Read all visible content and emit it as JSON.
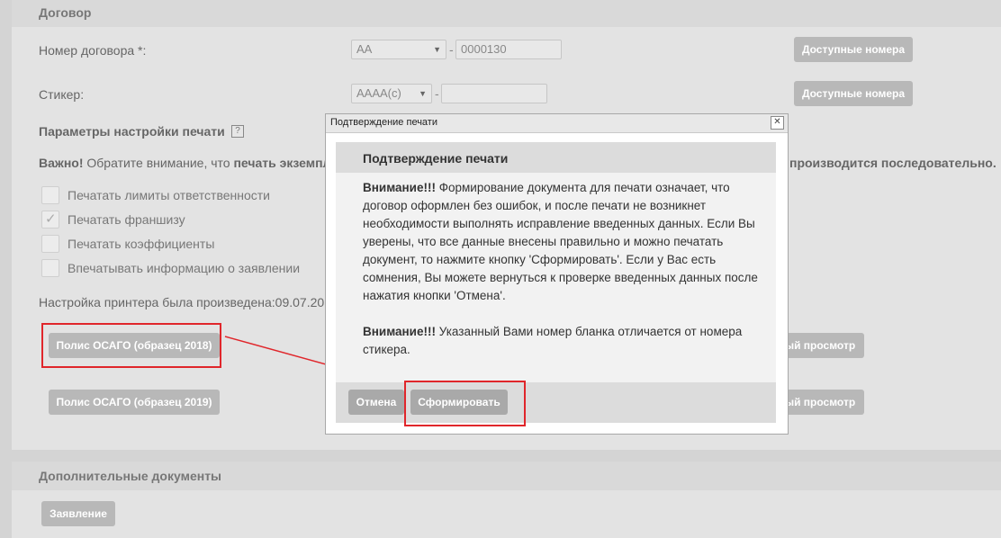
{
  "contract": {
    "section_title": "Договор",
    "number_label": "Номер договора *:",
    "series_value": "AA",
    "number_value": "0000130",
    "available_numbers_label": "Доступные номера",
    "sticker_label": "Стикер:",
    "sticker_series_value": "AAAA(c)",
    "sticker_number_value": "",
    "dash": "-"
  },
  "print_settings": {
    "title": "Параметры настройки печати",
    "help_glyph": "?",
    "important_bold": "Важно!",
    "important_text": " Обратите внимание, что ",
    "important_bold2": "печать экземпл",
    "important_tail": "производится последовательно.",
    "checkboxes": [
      {
        "label": "Печатать лимиты ответственности",
        "checked": false
      },
      {
        "label": "Печатать франшизу",
        "checked": true
      },
      {
        "label": "Печатать коэффициенты",
        "checked": false
      },
      {
        "label": "Впечатывать информацию о заявлении",
        "checked": false
      }
    ],
    "printer_setup_text": "Настройка принтера была произведена:09.07.20",
    "policy_2018_label": "Полис ОСАГО (образец 2018)",
    "policy_2019_label": "Полис ОСАГО (образец 2019)",
    "preview_label": "ый просмотр"
  },
  "additional_docs": {
    "title": "Дополнительные документы",
    "application_label": "Заявление"
  },
  "modal": {
    "window_title": "Подтверждение печати",
    "close_glyph": "✕",
    "header": "Подтверждение печати",
    "warning1_bold": "Внимание!!!",
    "warning1_text": " Формирование документа для печати означает, что договор оформлен без ошибок, и после печати не возникнет необходимости выполнять исправление введенных данных. Если Вы уверены, что все данные внесены правильно и можно печатать документ, то нажмите кнопку 'Сформировать'. Если у Вас есть сомнения, Вы можете вернуться к проверке введенных данных после нажатия кнопки 'Отмена'.",
    "warning2_bold": "Внимание!!!",
    "warning2_text": " Указанный Вами номер бланка отличается от номера стикера.",
    "cancel_label": "Отмена",
    "generate_label": "Сформировать"
  },
  "colors": {
    "annotation_red": "#e0262b",
    "button_gray": "#b8b8b8"
  }
}
